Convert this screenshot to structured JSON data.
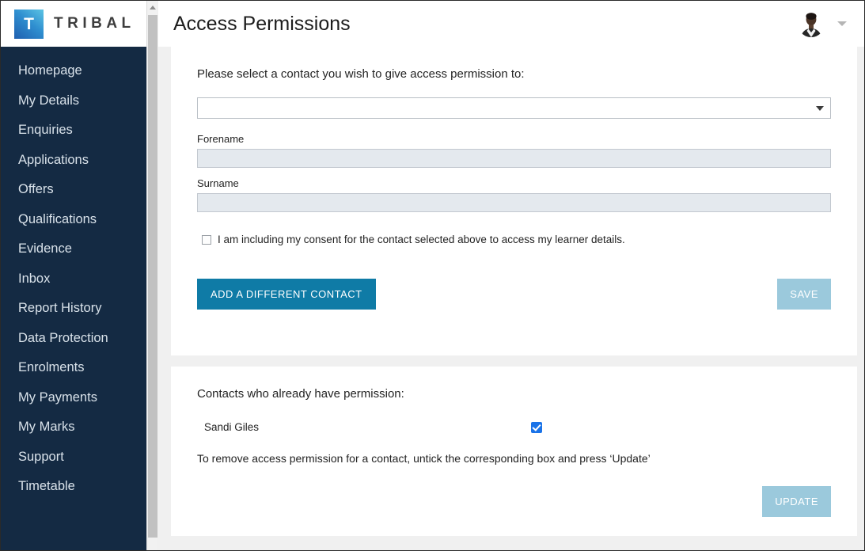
{
  "brand": {
    "mark_letter": "T",
    "name": "TRIBAL"
  },
  "sidebar": {
    "items": [
      {
        "label": "Homepage"
      },
      {
        "label": "My Details"
      },
      {
        "label": "Enquiries"
      },
      {
        "label": "Applications"
      },
      {
        "label": "Offers"
      },
      {
        "label": "Qualifications"
      },
      {
        "label": "Evidence"
      },
      {
        "label": "Inbox"
      },
      {
        "label": "Report History"
      },
      {
        "label": "Data Protection"
      },
      {
        "label": "Enrolments"
      },
      {
        "label": "My Payments"
      },
      {
        "label": "My Marks"
      },
      {
        "label": "Support"
      },
      {
        "label": "Timetable"
      }
    ]
  },
  "header": {
    "title": "Access Permissions",
    "avatar_alt": "user-avatar",
    "menu_caret": "chevron-down-icon"
  },
  "form_panel": {
    "lead": "Please select a contact you wish to give access permission to:",
    "contact_select": {
      "value": "",
      "placeholder": ""
    },
    "forename": {
      "label": "Forename",
      "value": "",
      "placeholder": ""
    },
    "surname": {
      "label": "Surname",
      "value": "",
      "placeholder": ""
    },
    "consent": {
      "checked": false,
      "text": "I am including my consent for the contact selected above to access my learner details."
    },
    "add_contact_label": "ADD A DIFFERENT CONTACT",
    "save_label": "SAVE"
  },
  "permissions_panel": {
    "lead": "Contacts who already have permission:",
    "contacts": [
      {
        "name": "Sandi Giles",
        "granted": true
      }
    ],
    "hint": "To remove access permission for a contact, untick the corresponding box and press ‘Update’",
    "update_label": "UPDATE"
  },
  "colors": {
    "sidebar_bg": "#142a43",
    "primary_button": "#0f7ba6",
    "muted_button": "#9bc9dc",
    "checkbox_checked": "#1a73e8",
    "content_bg": "#f0f0f0"
  }
}
